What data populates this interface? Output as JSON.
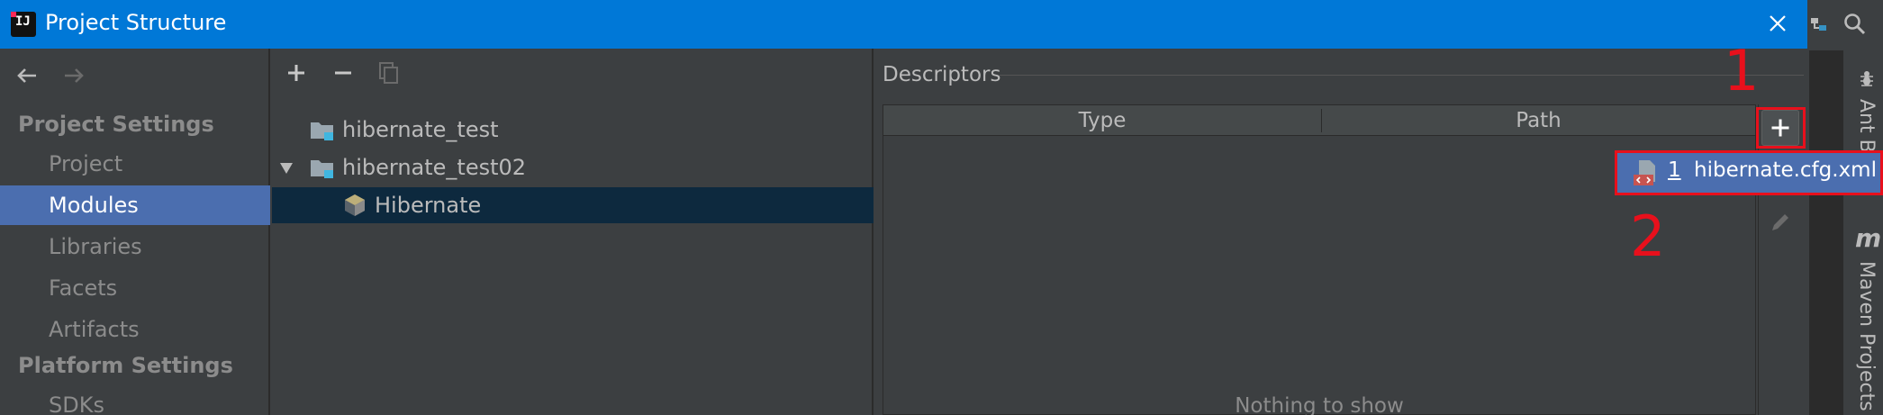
{
  "window": {
    "title": "Project Structure",
    "logo_text": "IJ"
  },
  "sidebar": {
    "section_project": "Project Settings",
    "project_items": [
      "Project",
      "Modules",
      "Libraries",
      "Facets",
      "Artifacts"
    ],
    "selected_item": "Modules",
    "section_platform": "Platform Settings",
    "platform_items": [
      "SDKs"
    ]
  },
  "modules_tree": {
    "items": [
      {
        "label": "hibernate_test",
        "level": 0,
        "expanded": false
      },
      {
        "label": "hibernate_test02",
        "level": 0,
        "expanded": true
      },
      {
        "label": "Hibernate",
        "level": 1,
        "selected": true
      }
    ]
  },
  "descriptors": {
    "title": "Descriptors",
    "columns": [
      "Type",
      "Path"
    ],
    "empty_text": "Nothing to show"
  },
  "popup": {
    "number": "1",
    "label": "hibernate.cfg.xml"
  },
  "right_toolwindows": {
    "ant_label": "Ant B",
    "maven_icon": "m",
    "maven_label": "Maven Projects"
  },
  "annotations": {
    "label_1": "1",
    "label_2": "2"
  },
  "colors": {
    "title_bar": "#0078d7",
    "selection": "#4b6eaf",
    "tree_selection": "#0d293e",
    "annotation_red": "#e8101c",
    "panel_bg": "#3c3f41"
  }
}
